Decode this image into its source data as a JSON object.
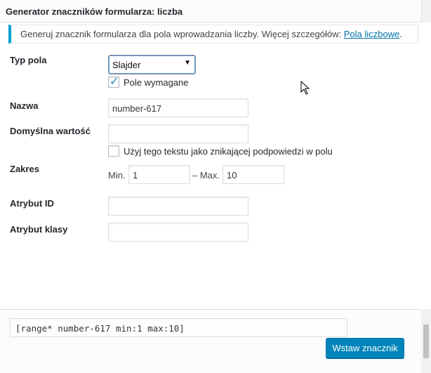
{
  "dialog": {
    "title": "Generator znaczników formularza: liczba"
  },
  "notice": {
    "text": "Generuj znacznik formularza dla pola wprowadzania liczby. Więcej szczegółów: ",
    "link": "Pola liczbowe",
    "suffix": "."
  },
  "fields": {
    "field_type": {
      "label": "Typ pola",
      "selected": "Slajder",
      "required_label": "Pole wymagane",
      "required_checked": true
    },
    "name": {
      "label": "Nazwa",
      "value": "number-617"
    },
    "default_value": {
      "label": "Domyślna wartość",
      "value": "",
      "placeholder_option_label": "Użyj tego tekstu jako znikającej podpowiedzi w polu",
      "placeholder_option_checked": false
    },
    "range": {
      "label": "Zakres",
      "min_label": "Min.",
      "min_value": "1",
      "max_label": "– Max.",
      "max_value": "10"
    },
    "id_attr": {
      "label": "Atrybut ID",
      "value": ""
    },
    "class_attr": {
      "label": "Atrybut klasy",
      "value": ""
    }
  },
  "footer": {
    "tag": "[range* number-617 min:1 max:10]",
    "insert_label": "Wstaw znacznik"
  }
}
